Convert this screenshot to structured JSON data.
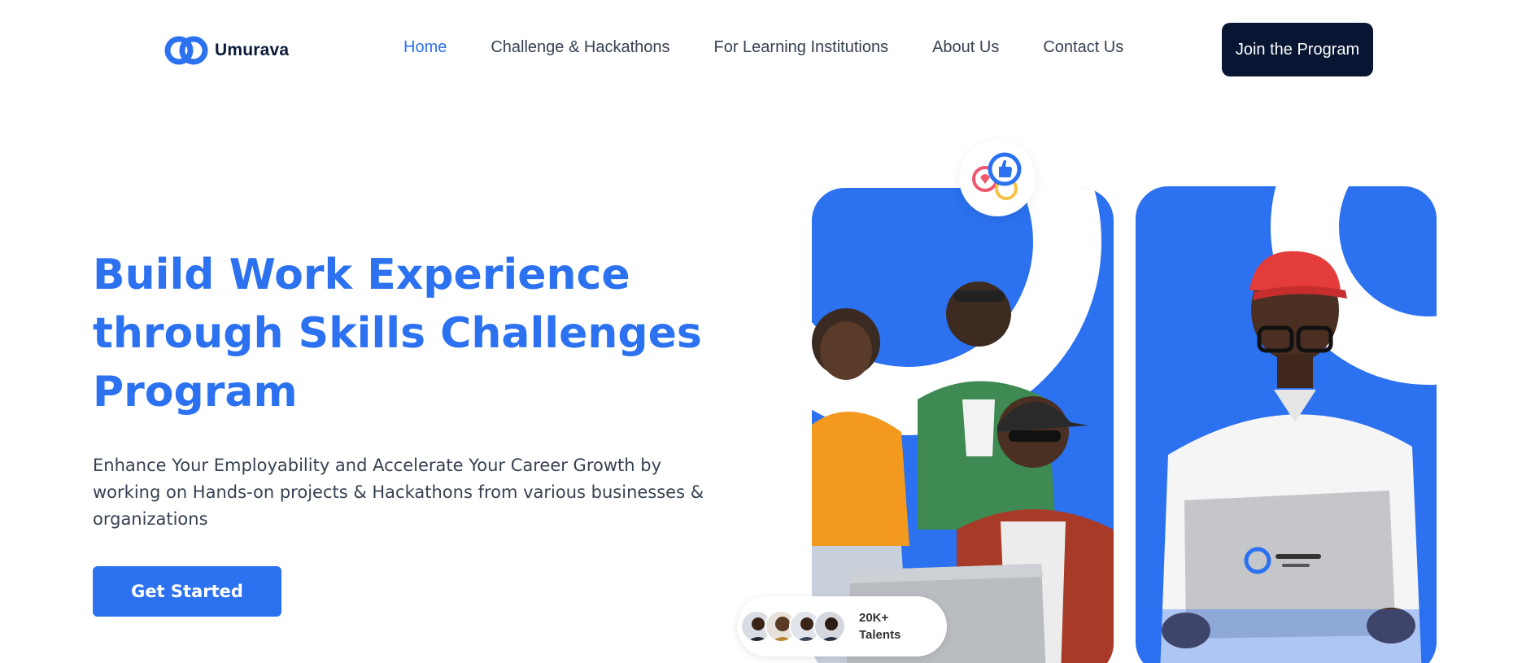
{
  "brand": {
    "name": "Umurava",
    "logo_icon": "chain-link-icon",
    "accent": "#2b71f0",
    "dark": "#081633"
  },
  "nav": {
    "links": [
      {
        "label": "Home",
        "active": true
      },
      {
        "label": "Challenge & Hackathons",
        "active": false
      },
      {
        "label": "For Learning Institutions",
        "active": false
      },
      {
        "label": "About Us",
        "active": false
      },
      {
        "label": "Contact Us",
        "active": false
      }
    ],
    "cta_label": "Join the Program"
  },
  "hero": {
    "title_lines": [
      "Build Work Experience",
      "through Skills Challenges",
      "Program"
    ],
    "subtitle": "Enhance Your Employability and Accelerate Your Career Growth by working on Hands-on projects & Hackathons from various businesses & organizations",
    "cta_label": "Get Started"
  },
  "talents_badge": {
    "count": "20K+",
    "label": "Talents"
  },
  "reactions_icon": "social-reactions-icon",
  "photo_cards": [
    "group-of-students-photo",
    "student-with-laptop-photo"
  ]
}
